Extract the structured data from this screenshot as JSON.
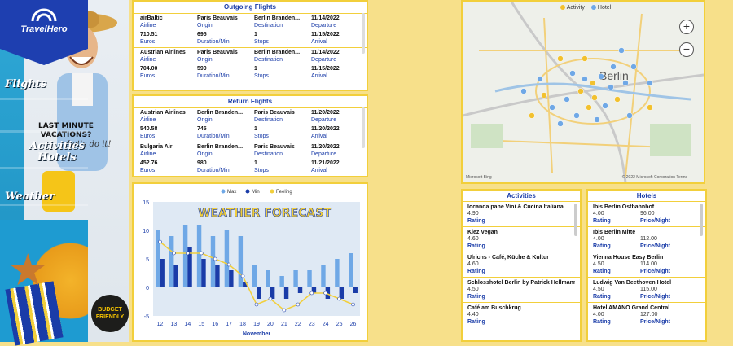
{
  "hero": {
    "tagline": "LAST MINUTE VACATIONS?",
    "script": "Let's do it!",
    "badge": "BUDGET FRIENDLY"
  },
  "outgoing": {
    "title": "Outgoing Flights",
    "flights": [
      {
        "airline": "airBaltic",
        "origin": "Paris Beauvais",
        "destination": "Berlin Branden...",
        "departure": "11/14/2022",
        "price": "710.51",
        "duration": "695",
        "stops": "1",
        "arrival": "11/15/2022"
      },
      {
        "airline": "Austrian Airlines",
        "origin": "Paris Beauvais",
        "destination": "Berlin Branden...",
        "departure": "11/14/2022",
        "price": "704.00",
        "duration": "590",
        "stops": "1",
        "arrival": "11/15/2022"
      }
    ]
  },
  "return": {
    "title": "Return Flights",
    "flights": [
      {
        "airline": "Austrian Airlines",
        "origin": "Berlin Branden...",
        "destination": "Paris Beauvais",
        "departure": "11/20/2022",
        "price": "540.58",
        "duration": "745",
        "stops": "1",
        "arrival": "11/20/2022"
      },
      {
        "airline": "Bulgaria Air",
        "origin": "Berlin Branden...",
        "destination": "Paris Beauvais",
        "departure": "11/20/2022",
        "price": "452.76",
        "duration": "980",
        "stops": "1",
        "arrival": "11/21/2022"
      }
    ]
  },
  "labels": {
    "airline": "Airline",
    "origin": "Origin",
    "destination": "Destination",
    "departure": "Departure",
    "euros": "Euros",
    "duration": "Duration/Min",
    "stops": "Stops",
    "arrival": "Arrival",
    "rating": "Rating",
    "price_night": "Price/Night"
  },
  "chart_data": {
    "type": "bar",
    "title": "WEATHER FORECAST",
    "xlabel": "November",
    "ylim": [
      -5,
      15
    ],
    "yticks": [
      -5,
      0,
      5,
      10,
      15
    ],
    "categories": [
      "12",
      "13",
      "14",
      "15",
      "16",
      "17",
      "18",
      "19",
      "20",
      "21",
      "22",
      "23",
      "24",
      "25",
      "26"
    ],
    "series": [
      {
        "name": "Max",
        "color": "#6fa8e6",
        "values": [
          10,
          9,
          11,
          11,
          9,
          10,
          9,
          4,
          3,
          2,
          3,
          3,
          4,
          5,
          6
        ]
      },
      {
        "name": "Min",
        "color": "#1a3ca8",
        "values": [
          5,
          4,
          7,
          5,
          4,
          3,
          1,
          -2,
          -2,
          -2,
          -1,
          -1,
          -2,
          -2,
          -1
        ]
      },
      {
        "name": "Feeling",
        "color": "#f2cf3b",
        "values": [
          8,
          6,
          6,
          6,
          5,
          4,
          2,
          -3,
          -2,
          -4,
          -3,
          -1,
          -1,
          -2,
          -3
        ]
      }
    ]
  },
  "brand": {
    "name": "TravelHero",
    "words": [
      "Flights",
      "Activities",
      "Hotels",
      "Weather"
    ]
  },
  "map": {
    "legend": [
      {
        "name": "Activity",
        "color": "#f2c12e"
      },
      {
        "name": "Hotel",
        "color": "#6fa8e6"
      }
    ],
    "city": "Berlin",
    "credit": "© 2022 Microsoft Corporation  Terms",
    "logo": "Microsoft Bing",
    "zoom_in": "+",
    "zoom_out": "−"
  },
  "activities": {
    "title": "Activities",
    "items": [
      {
        "name": "locanda pane Vini & Cucina Italiana",
        "rating": "4.90"
      },
      {
        "name": "Kiez Vegan",
        "rating": "4.60"
      },
      {
        "name": "Ulrichs - Café, Küche & Kultur",
        "rating": "4.60"
      },
      {
        "name": "Schlosshotel Berlin by Patrick Hellmann",
        "rating": "4.50"
      },
      {
        "name": "Café am Buschkrug",
        "rating": "4.40"
      }
    ]
  },
  "hotels": {
    "title": "Hotels",
    "items": [
      {
        "name": "Ibis Berlin Ostbahnhof",
        "rating": "4.00",
        "price": "96.00"
      },
      {
        "name": "Ibis Berlin Mitte",
        "rating": "4.00",
        "price": "112.00"
      },
      {
        "name": "Vienna House Easy Berlin",
        "rating": "4.50",
        "price": "114.00"
      },
      {
        "name": "Ludwig Van Beethoven Hotel",
        "rating": "4.50",
        "price": "115.00"
      },
      {
        "name": "Hotel AMANO Grand Central",
        "rating": "4.00",
        "price": "127.00"
      }
    ]
  }
}
